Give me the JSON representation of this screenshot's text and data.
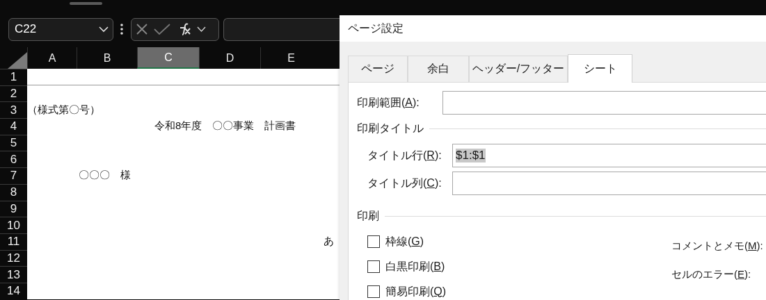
{
  "formula_bar": {
    "name_box": "C22"
  },
  "sheet": {
    "columns": [
      {
        "label": "A",
        "selected": false
      },
      {
        "label": "B",
        "selected": false
      },
      {
        "label": "C",
        "selected": true
      },
      {
        "label": "D",
        "selected": false
      },
      {
        "label": "E",
        "selected": false
      }
    ],
    "rows": [
      {
        "number": "1"
      },
      {
        "number": "2"
      },
      {
        "number": "3",
        "kind": "form-number",
        "text": "（様式第〇号）"
      },
      {
        "number": "4",
        "kind": "title",
        "text": "令和8年度　〇〇事業　計画書"
      },
      {
        "number": "5"
      },
      {
        "number": "6"
      },
      {
        "number": "7",
        "kind": "addressee",
        "text": "〇〇〇　様"
      },
      {
        "number": "8"
      },
      {
        "number": "9"
      },
      {
        "number": "10"
      },
      {
        "number": "11",
        "kind": "body",
        "text": "あ"
      },
      {
        "number": "12"
      },
      {
        "number": "13"
      },
      {
        "number": "14"
      }
    ]
  },
  "dialog": {
    "title": "ページ設定",
    "tabs": [
      {
        "label": "ページ",
        "selected": false
      },
      {
        "label": "余白",
        "selected": false
      },
      {
        "label": "ヘッダー/フッター",
        "selected": false
      },
      {
        "label": "シート",
        "selected": true
      }
    ],
    "print_area": {
      "label": {
        "before": "印刷範囲(",
        "key": "A",
        "after": "):"
      }
    },
    "print_titles": {
      "heading": "印刷タイトル",
      "fields": [
        {
          "label": {
            "before": "タイトル行(",
            "key": "R",
            "after": "):"
          },
          "value": {
            "text": "$1:$1",
            "selected": true
          }
        },
        {
          "label": {
            "before": "タイトル列(",
            "key": "C",
            "after": "):"
          }
        }
      ]
    },
    "print": {
      "heading": "印刷",
      "options": [
        {
          "label": {
            "before": "枠線(",
            "key": "G",
            "after": ")"
          },
          "checked": false
        },
        {
          "label": {
            "before": "白黒印刷(",
            "key": "B",
            "after": ")"
          },
          "checked": false
        },
        {
          "label": {
            "before": "簡易印刷(",
            "key": "Q",
            "after": ")"
          },
          "checked": false
        }
      ],
      "settings": [
        {
          "label": {
            "before": "コメントとメモ(",
            "key": "M",
            "after": "):"
          }
        },
        {
          "label": {
            "before": "セルのエラー(",
            "key": "E",
            "after": "):"
          }
        }
      ]
    }
  }
}
